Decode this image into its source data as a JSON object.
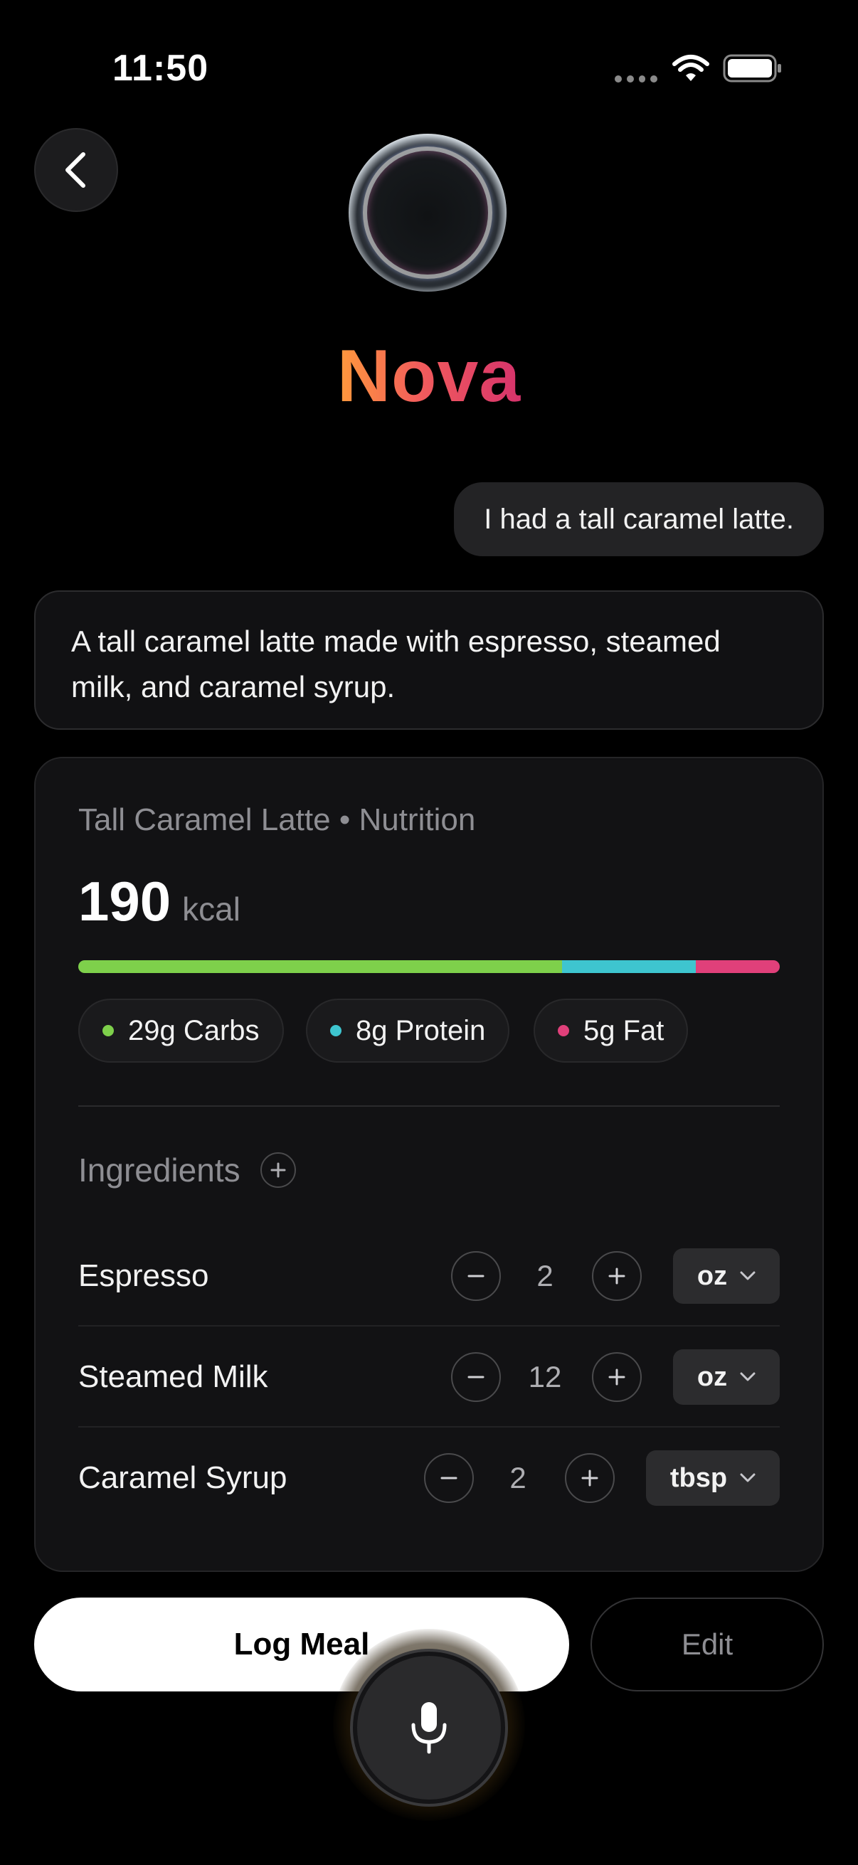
{
  "status_bar": {
    "time": "11:50"
  },
  "header": {
    "title": "Nova"
  },
  "chat": {
    "user_message": "I had a tall caramel latte.",
    "assistant_message": "A tall caramel latte made with espresso, steamed milk, and caramel syrup."
  },
  "nutrition": {
    "title": "Tall Caramel Latte • Nutrition",
    "calories": "190",
    "calories_unit": "kcal",
    "macro_fractions": {
      "carbs": 0.69,
      "protein": 0.19,
      "fat": 0.12
    },
    "macros": [
      {
        "label": "29g Carbs",
        "color": "#7ed04b"
      },
      {
        "label": "8g Protein",
        "color": "#3ec5cf"
      },
      {
        "label": "5g Fat",
        "color": "#e0407a"
      }
    ]
  },
  "ingredients": {
    "heading": "Ingredients",
    "items": [
      {
        "name": "Espresso",
        "quantity": "2",
        "unit": "oz"
      },
      {
        "name": "Steamed Milk",
        "quantity": "12",
        "unit": "oz"
      },
      {
        "name": "Caramel Syrup",
        "quantity": "2",
        "unit": "tbsp"
      }
    ]
  },
  "actions": {
    "log_label": "Log Meal",
    "edit_label": "Edit"
  },
  "icons": {
    "back": "chevron-left-icon",
    "add": "plus-icon",
    "decrement": "minus-icon",
    "increment": "plus-icon",
    "dropdown": "chevron-down-icon",
    "mic": "microphone-icon"
  }
}
